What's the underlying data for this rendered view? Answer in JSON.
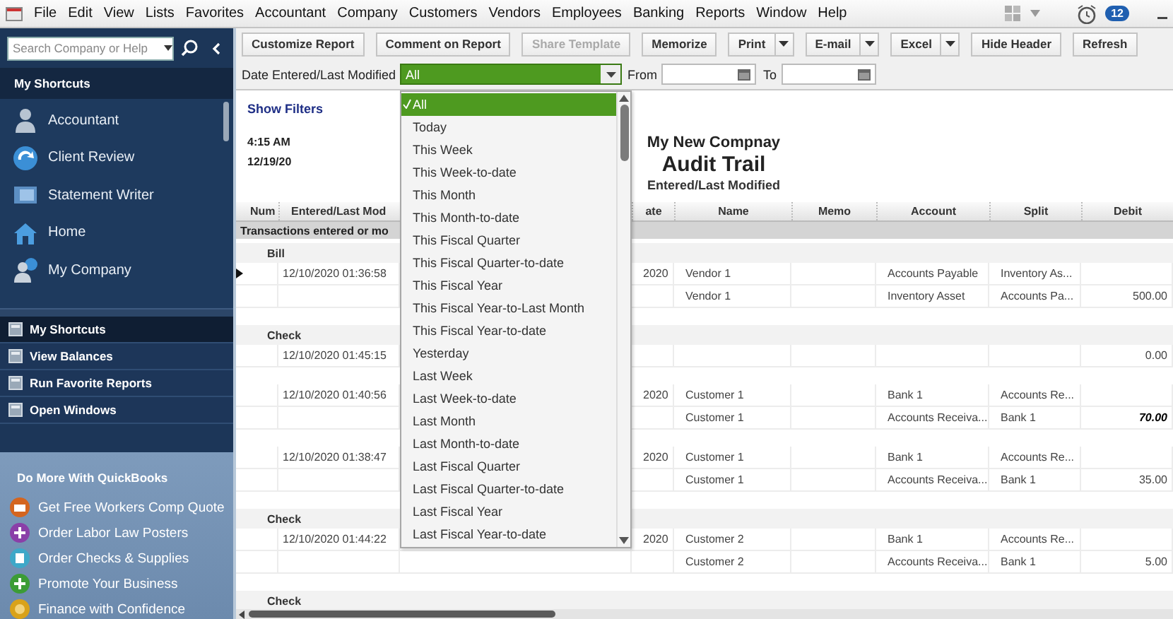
{
  "menu_bar": {
    "items": [
      "File",
      "Edit",
      "View",
      "Lists",
      "Favorites",
      "Accountant",
      "Company",
      "Customers",
      "Vendors",
      "Employees",
      "Banking",
      "Reports",
      "Window",
      "Help"
    ],
    "notification_count": "12"
  },
  "sidebar": {
    "search": {
      "placeholder": "Search Company or Help"
    },
    "header": "My Shortcuts",
    "shortcuts": [
      "Accountant",
      "Client Review",
      "Statement Writer",
      "Home",
      "My Company"
    ],
    "nav": [
      {
        "label": "My Shortcuts",
        "selected": true
      },
      {
        "label": "View Balances",
        "selected": false
      },
      {
        "label": "Run Favorite Reports",
        "selected": false
      },
      {
        "label": "Open Windows",
        "selected": false
      }
    ],
    "promo": {
      "title": "Do More With QuickBooks",
      "items": [
        "Get Free Workers Comp Quote",
        "Order Labor Law Posters",
        "Order Checks & Supplies",
        "Promote Your Business",
        "Finance with Confidence"
      ]
    }
  },
  "toolbar": {
    "buttons": [
      {
        "label": "Customize Report",
        "disabled": false,
        "menu": false
      },
      {
        "label": "Comment on Report",
        "disabled": false,
        "menu": false
      },
      {
        "label": "Share Template",
        "disabled": true,
        "menu": false
      },
      {
        "label": "Memorize",
        "disabled": false,
        "menu": false
      },
      {
        "label": "Print",
        "disabled": false,
        "menu": true
      },
      {
        "label": "E-mail",
        "disabled": false,
        "menu": true
      },
      {
        "label": "Excel",
        "disabled": false,
        "menu": true
      },
      {
        "label": "Hide Header",
        "disabled": false,
        "menu": false
      },
      {
        "label": "Refresh",
        "disabled": false,
        "menu": false
      }
    ]
  },
  "filter": {
    "label": "Date Entered/Last Modified",
    "value": "All",
    "from_label": "From",
    "to_label": "To"
  },
  "date_menu": {
    "options": [
      {
        "label": "All",
        "selected": true
      },
      {
        "label": "Today",
        "selected": false
      },
      {
        "label": "This Week",
        "selected": false
      },
      {
        "label": "This Week-to-date",
        "selected": false
      },
      {
        "label": "This Month",
        "selected": false
      },
      {
        "label": "This Month-to-date",
        "selected": false
      },
      {
        "label": "This Fiscal Quarter",
        "selected": false
      },
      {
        "label": "This Fiscal Quarter-to-date",
        "selected": false
      },
      {
        "label": "This Fiscal Year",
        "selected": false
      },
      {
        "label": "This Fiscal Year-to-Last Month",
        "selected": false
      },
      {
        "label": "This Fiscal Year-to-date",
        "selected": false
      },
      {
        "label": "Yesterday",
        "selected": false
      },
      {
        "label": "Last Week",
        "selected": false
      },
      {
        "label": "Last Week-to-date",
        "selected": false
      },
      {
        "label": "Last Month",
        "selected": false
      },
      {
        "label": "Last Month-to-date",
        "selected": false
      },
      {
        "label": "Last Fiscal Quarter",
        "selected": false
      },
      {
        "label": "Last Fiscal Quarter-to-date",
        "selected": false
      },
      {
        "label": "Last Fiscal Year",
        "selected": false
      },
      {
        "label": "Last Fiscal Year-to-date",
        "selected": false
      }
    ]
  },
  "report": {
    "show_filters": "Show Filters",
    "time": "4:15 AM",
    "date": "12/19/20",
    "company": "My New Compnay",
    "title": "Audit Trail",
    "subtitle": "Entered/Last Modified",
    "columns": [
      "Num",
      "Entered/Last Mod",
      "ate",
      "Name",
      "Memo",
      "Account",
      "Split",
      "Debit"
    ],
    "section": "Transactions entered or mo",
    "groups": [
      {
        "type": "Bill",
        "transactions": [
          {
            "lines": [
              {
                "entered": "12/10/2020 01:36:58",
                "date": "2020",
                "name": "Vendor 1",
                "account": "Accounts Payable",
                "split": "Inventory As...",
                "current": true
              },
              {
                "name": "Vendor 1",
                "account": "Inventory Asset",
                "split": "Accounts Pa...",
                "debit": "500.00",
                "current": false,
                "emphasized": false
              }
            ]
          }
        ]
      },
      {
        "type": "Check",
        "transactions": [
          {
            "lines": [
              {
                "entered": "12/10/2020 01:45:15",
                "debit": "0.00",
                "current": false,
                "emphasized": false
              }
            ]
          },
          {
            "lines": [
              {
                "entered": "12/10/2020 01:40:56",
                "date": "2020",
                "name": "Customer 1",
                "account": "Bank 1",
                "split": "Accounts Re...",
                "current": false
              },
              {
                "name": "Customer 1",
                "account": "Accounts Receiva...",
                "split": "Bank 1",
                "debit": "70.00",
                "current": false,
                "emphasized": true
              }
            ]
          },
          {
            "lines": [
              {
                "entered": "12/10/2020 01:38:47",
                "date": "2020",
                "name": "Customer 1",
                "account": "Bank 1",
                "split": "Accounts Re...",
                "current": false
              },
              {
                "name": "Customer 1",
                "account": "Accounts Receiva...",
                "split": "Bank 1",
                "debit": "35.00",
                "current": false,
                "emphasized": false
              }
            ]
          }
        ]
      },
      {
        "type": "Check",
        "transactions": [
          {
            "lines": [
              {
                "entered": "12/10/2020 01:44:22",
                "date": "2020",
                "name": "Customer 2",
                "account": "Bank 1",
                "split": "Accounts Re...",
                "current": false
              },
              {
                "name": "Customer 2",
                "account": "Accounts Receiva...",
                "split": "Bank 1",
                "debit": "5.00",
                "current": false,
                "emphasized": false
              }
            ]
          }
        ]
      },
      {
        "type": "Check"
      }
    ]
  }
}
